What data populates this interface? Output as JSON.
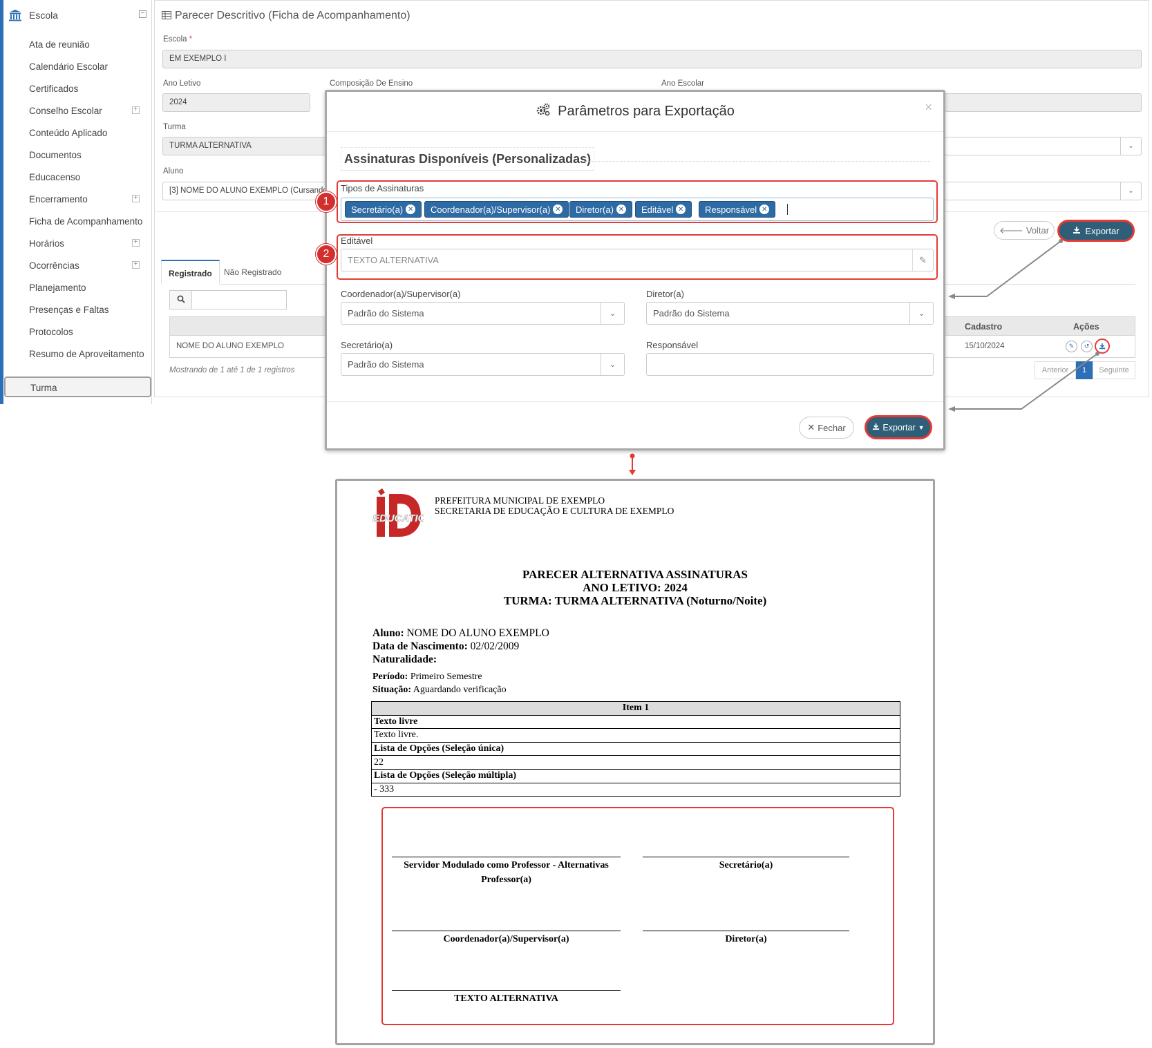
{
  "sidebar": {
    "header": "Escola",
    "items": [
      {
        "label": "Ata de reunião",
        "expandable": false
      },
      {
        "label": "Calendário Escolar",
        "expandable": false
      },
      {
        "label": "Certificados",
        "expandable": false
      },
      {
        "label": "Conselho Escolar",
        "expandable": true
      },
      {
        "label": "Conteúdo Aplicado",
        "expandable": false
      },
      {
        "label": "Documentos",
        "expandable": false
      },
      {
        "label": "Educacenso",
        "expandable": false
      },
      {
        "label": "Encerramento",
        "expandable": true
      },
      {
        "label": "Ficha de Acompanhamento",
        "expandable": false
      },
      {
        "label": "Horários",
        "expandable": true
      },
      {
        "label": "Ocorrências",
        "expandable": true
      },
      {
        "label": "Planejamento",
        "expandable": false
      },
      {
        "label": "Presenças e Faltas",
        "expandable": false
      },
      {
        "label": "Protocolos",
        "expandable": false
      },
      {
        "label": "Resumo de Aproveitamento",
        "expandable": false
      },
      {
        "label": "Turma",
        "expandable": false,
        "active": true
      }
    ]
  },
  "main": {
    "title": "Parecer Descritivo (Ficha de Acompanhamento)",
    "escola_label": "Escola",
    "escola_value": "EM EXEMPLO I",
    "ano_letivo_label": "Ano Letivo",
    "ano_letivo_value": "2024",
    "composicao_label": "Composição De Ensino",
    "ano_escolar_label": "Ano Escolar",
    "turma_label": "Turma",
    "turma_value": "TURMA ALTERNATIVA",
    "aluno_label": "Aluno",
    "aluno_value": "[3] NOME DO ALUNO EXEMPLO (Cursando)",
    "voltar_label": "Voltar",
    "exportar_label": "Exportar",
    "tabs": [
      "Registrado",
      "Não Registrado"
    ],
    "grid": {
      "columns": [
        "Cadastro",
        "Ações"
      ],
      "rows": [
        {
          "nome": "NOME DO ALUNO EXEMPLO",
          "cadastro": "15/10/2024"
        }
      ]
    },
    "showing": "Mostrando de 1 até 1 de 1 registros",
    "pager": {
      "prev": "Anterior",
      "current": "1",
      "next": "Seguinte"
    }
  },
  "modal": {
    "title": "Parâmetros para Exportação",
    "close": "×",
    "section": "Assinaturas Disponíveis (Personalizadas)",
    "tipos_label": "Tipos de Assinaturas",
    "tags": [
      "Secretário(a)",
      "Coordenador(a)/Supervisor(a)",
      "Diretor(a)",
      "Editável",
      "Responsável"
    ],
    "editavel_label": "Editável",
    "editavel_placeholder": "TEXTO ALTERNATIVA",
    "coord_label": "Coordenador(a)/Supervisor(a)",
    "coord_value": "Padrão do Sistema",
    "diretor_label": "Diretor(a)",
    "diretor_value": "Padrão do Sistema",
    "secretario_label": "Secretário(a)",
    "secretario_value": "Padrão do Sistema",
    "responsavel_label": "Responsável",
    "responsavel_value": "",
    "fechar_label": "Fechar",
    "exportar_label": "Exportar",
    "badges": [
      "1",
      "2"
    ]
  },
  "doc": {
    "logo_text": "EDUCATION",
    "header_line1": "PREFEITURA MUNICIPAL DE EXEMPLO",
    "header_line2": "SECRETARIA DE EDUCAÇÃO E CULTURA DE EXEMPLO",
    "title1": "PARECER ALTERNATIVA ASSINATURAS",
    "title2": "ANO LETIVO: 2024",
    "title3": "TURMA: TURMA ALTERNATIVA (Noturno/Noite)",
    "aluno_label": "Aluno:",
    "aluno_value": "NOME DO ALUNO EXEMPLO",
    "nasc_label": "Data de Nascimento:",
    "nasc_value": "02/02/2009",
    "natur_label": "Naturalidade:",
    "periodo_label": "Período:",
    "periodo_value": "Primeiro Semestre",
    "situacao_label": "Situação:",
    "situacao_value": "Aguardando verificação",
    "table": {
      "header": "Item 1",
      "rows": [
        {
          "text": "Texto livre",
          "bold": true
        },
        {
          "text": "Texto livre.",
          "bold": false
        },
        {
          "text": "Lista de Opções (Seleção única)",
          "bold": true
        },
        {
          "text": "22",
          "bold": false
        },
        {
          "text": "Lista de Opções (Seleção múltipla)",
          "bold": true
        },
        {
          "text": "- 333",
          "bold": false
        }
      ]
    },
    "signatures": {
      "professor_line1": "Servidor Modulado como Professor - Alternativas",
      "professor_line2": "Professor(a)",
      "secretario": "Secretário(a)",
      "coordenador": "Coordenador(a)/Supervisor(a)",
      "diretor": "Diretor(a)",
      "editavel": "TEXTO ALTERNATIVA"
    }
  },
  "colors": {
    "accent": "#2c6fb7",
    "button_dark": "#2f5f78",
    "highlight": "#e53935",
    "tag": "#2e6ba4"
  }
}
